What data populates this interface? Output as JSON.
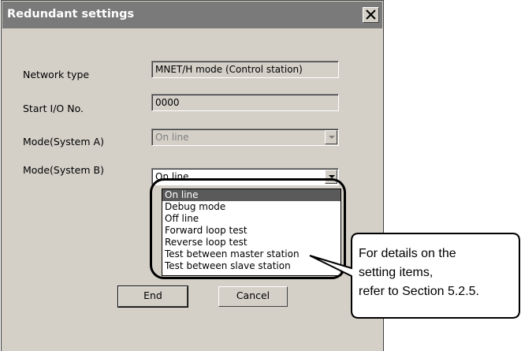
{
  "window": {
    "title": "Redundant settings"
  },
  "form": {
    "network_type": {
      "label": "Network type",
      "value": "MNET/H mode (Control station)"
    },
    "start_io": {
      "label": "Start I/O No.",
      "value": "0000"
    },
    "mode_a": {
      "label": "Mode(System A)",
      "value": "On line"
    },
    "mode_b": {
      "label": "Mode(System B)",
      "value": "On line"
    }
  },
  "dropdown": {
    "options": [
      "On line",
      "Debug mode",
      "Off line",
      "Forward loop test",
      "Reverse loop test",
      "Test between master station",
      "Test between slave station"
    ],
    "selected": "On line"
  },
  "buttons": {
    "end": "End",
    "cancel": "Cancel"
  },
  "callout": {
    "lines": [
      "For details on the",
      "setting items,",
      "refer to Section 5.2.5."
    ]
  },
  "colors": {
    "dialog_bg": "#d4d0c8",
    "titlebar": "#7a7a7a",
    "selection": "#5a5a5a"
  }
}
